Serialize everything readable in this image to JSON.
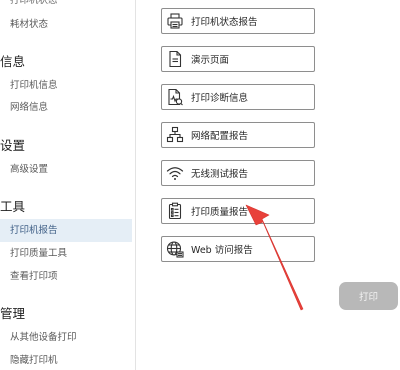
{
  "sidebar": {
    "items": [
      {
        "label": "打印机状态",
        "type": "item-cut"
      },
      {
        "label": "耗材状态",
        "type": "item"
      },
      {
        "label": "信息",
        "type": "header"
      },
      {
        "label": "打印机信息",
        "type": "item"
      },
      {
        "label": "网络信息",
        "type": "item"
      },
      {
        "label": "设置",
        "type": "header"
      },
      {
        "label": "高级设置",
        "type": "item"
      },
      {
        "label": "工具",
        "type": "header"
      },
      {
        "label": "打印机报告",
        "type": "item",
        "selected": true
      },
      {
        "label": "打印质量工具",
        "type": "item"
      },
      {
        "label": "查看打印项",
        "type": "item"
      },
      {
        "label": "管理",
        "type": "header"
      },
      {
        "label": "从其他设备打印",
        "type": "item"
      },
      {
        "label": "隐藏打印机",
        "type": "item"
      }
    ]
  },
  "reports": [
    {
      "label": "打印机状态报告",
      "icon": "printer-icon"
    },
    {
      "label": "演示页面",
      "icon": "document-icon"
    },
    {
      "label": "打印诊断信息",
      "icon": "diagnostic-icon"
    },
    {
      "label": "网络配置报告",
      "icon": "network-icon"
    },
    {
      "label": "无线测试报告",
      "icon": "wifi-icon"
    },
    {
      "label": "打印质量报告",
      "icon": "quality-report-icon"
    },
    {
      "label": "Web 访问报告",
      "icon": "web-icon"
    }
  ],
  "actions": {
    "print_label": "打印"
  },
  "colors": {
    "selected_bg": "#e5eef6",
    "selected_text": "#3f5f86",
    "annotation_arrow": "#e8413a",
    "print_button_bg": "#b8b8b8"
  }
}
